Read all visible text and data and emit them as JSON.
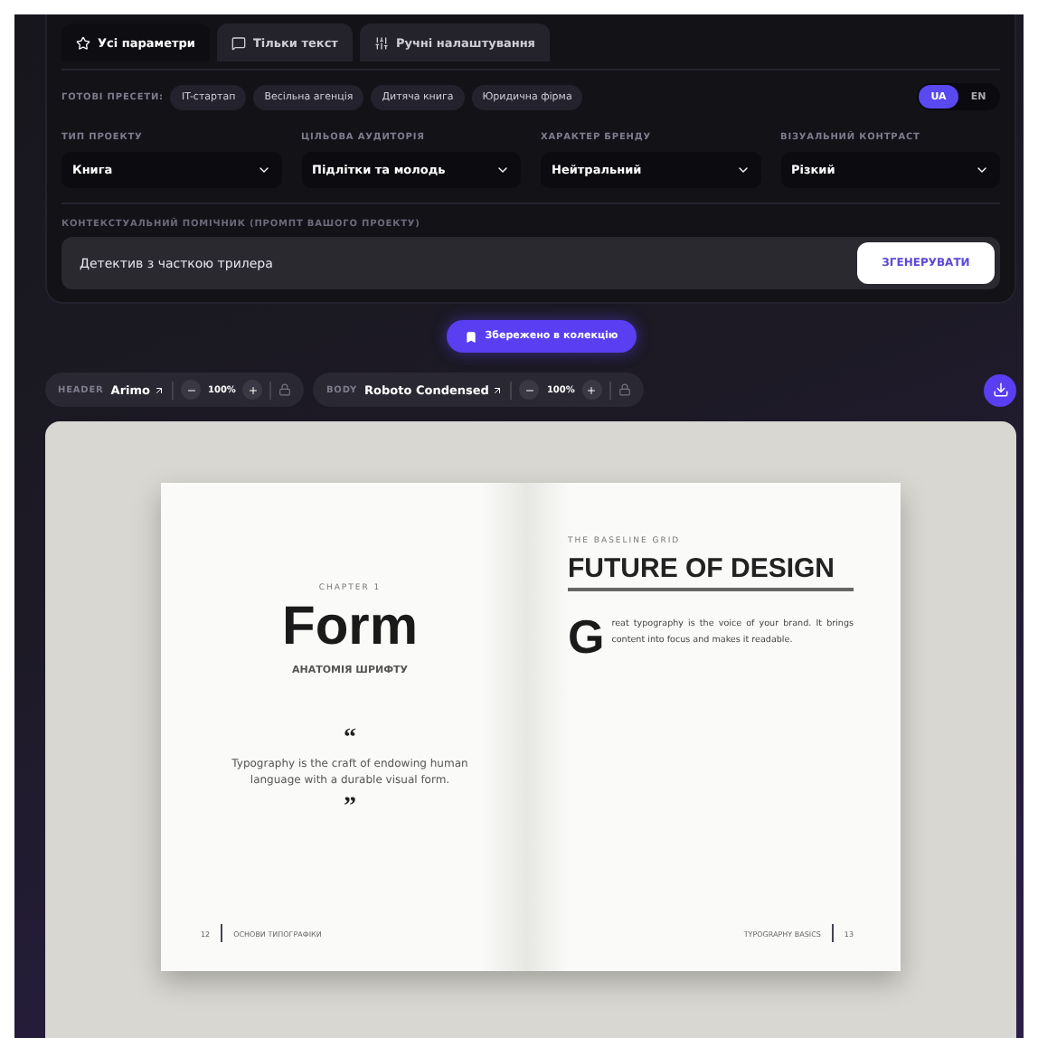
{
  "tabs": [
    {
      "label": "Усі параметри",
      "selected": true
    },
    {
      "label": "Тільки текст",
      "selected": false
    },
    {
      "label": "Ручні налаштування",
      "selected": false
    }
  ],
  "presets": {
    "label": "ГОТОВІ ПРЕСЕТИ:",
    "items": [
      "IT-стартап",
      "Весільна агенція",
      "Дитяча книга",
      "Юридична фірма"
    ]
  },
  "language": [
    {
      "label": "UA",
      "selected": true
    },
    {
      "label": "EN",
      "selected": false
    }
  ],
  "fields": [
    {
      "label": "ТИП ПРОЕКТУ",
      "value": "Книга"
    },
    {
      "label": "ЦІЛЬОВА АУДИТОРІЯ",
      "value": "Підлітки та молодь"
    },
    {
      "label": "ХАРАКТЕР БРЕНДУ",
      "value": "Нейтральний"
    },
    {
      "label": "ВІЗУАЛЬНИЙ КОНТРАСТ",
      "value": "Різкий"
    }
  ],
  "context": {
    "label": "КОНТЕКСТУАЛЬНИЙ ПОМІЧНИК (ПРОМПТ ВАШОГО ПРОЕКТУ)",
    "value": "Детектив з часткою трилера",
    "button": "ЗГЕНЕРУВАТИ"
  },
  "save_button": "Збережено в колекцію",
  "font_controls": [
    {
      "role": "HEADER",
      "font": "Arimo",
      "scale": "100%"
    },
    {
      "role": "BODY",
      "font": "Roboto Condensed",
      "scale": "100%"
    }
  ],
  "book": {
    "left": {
      "eyebrow": "CHAPTER 1",
      "title": "Form",
      "subtitle": "АНАТОМІЯ ШРИФТУ",
      "open_quote": "“",
      "quote": "Typography is the craft of endowing human language with a durable visual form.",
      "close_quote": "”",
      "page_number": "12",
      "running_head": "ОСНОВИ ТИПОГРАФІКИ"
    },
    "right": {
      "eyebrow": "THE BASELINE GRID",
      "title": "FUTURE OF DESIGN",
      "drop_cap": "G",
      "body": "reat typography is the voice of your brand. It brings content into focus and makes it readable.",
      "running_head": "TYPOGRAPHY BASICS",
      "page_number": "13"
    }
  }
}
